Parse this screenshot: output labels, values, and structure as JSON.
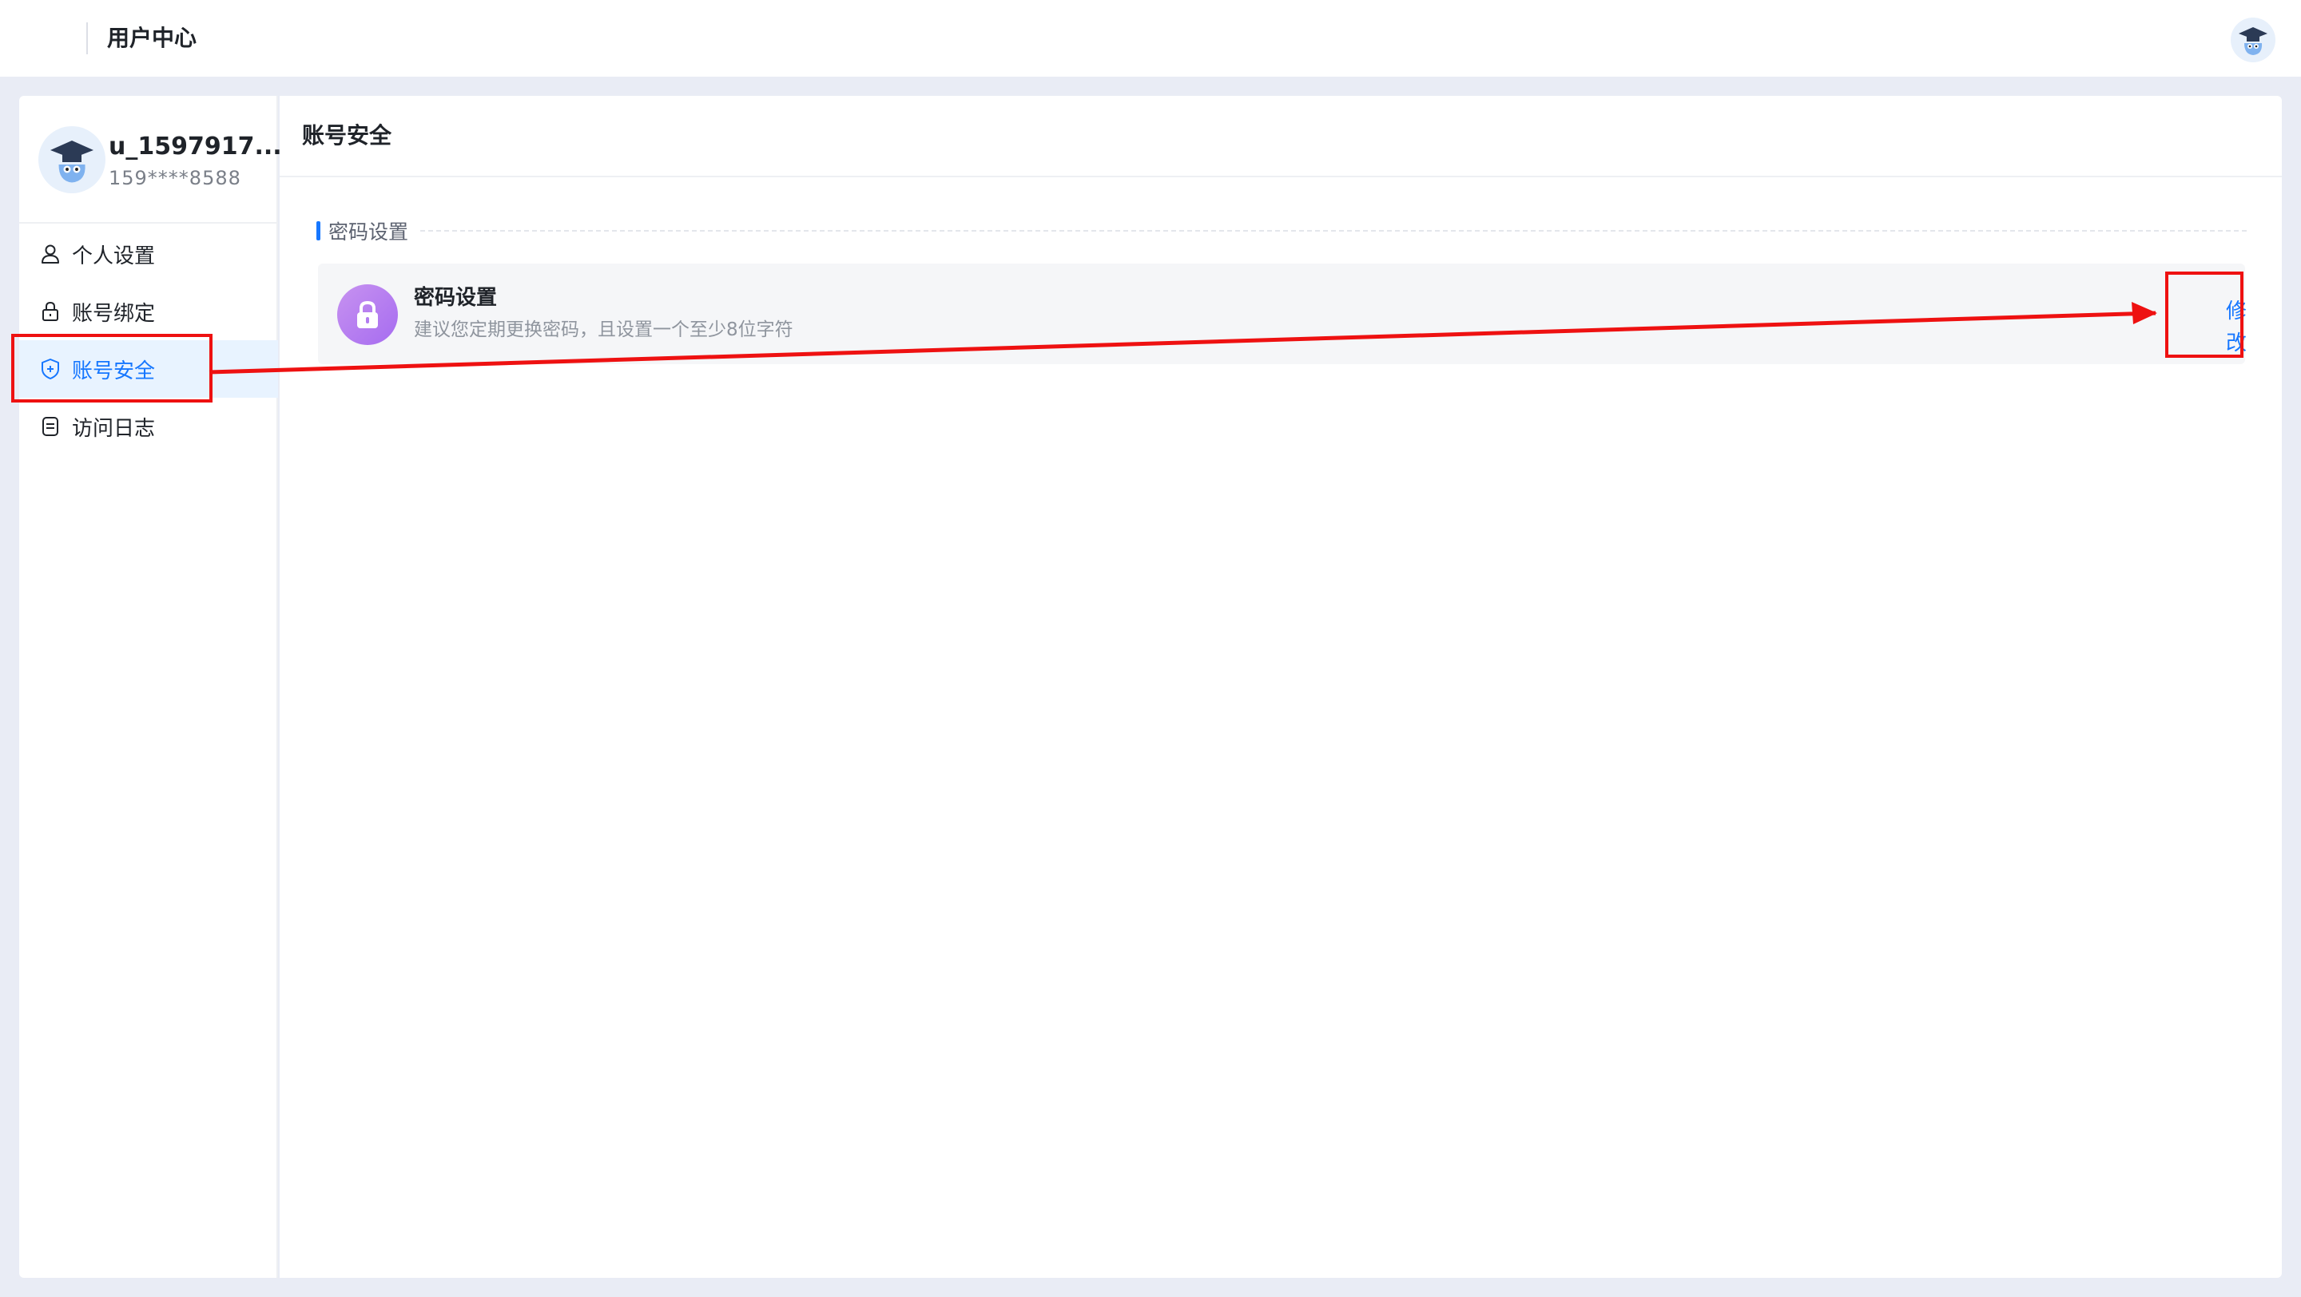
{
  "header": {
    "title": "用户中心"
  },
  "profile": {
    "username": "u_1597917...",
    "phone": "159****8588"
  },
  "sidebar": {
    "items": [
      {
        "label": "个人设置",
        "icon": "user-icon",
        "active": false
      },
      {
        "label": "账号绑定",
        "icon": "lock-icon",
        "active": false
      },
      {
        "label": "账号安全",
        "icon": "shield-icon",
        "active": true
      },
      {
        "label": "访问日志",
        "icon": "document-icon",
        "active": false
      }
    ]
  },
  "main": {
    "title": "账号安全",
    "section_title": "密码设置",
    "card": {
      "icon": "lock-icon",
      "title": "密码设置",
      "description": "建议您定期更换密码，且设置一个至少8位字符",
      "action_label": "修改"
    }
  },
  "colors": {
    "accent": "#1677ff",
    "annotation": "#ee1111",
    "lock_gradient_start": "#c792f0",
    "lock_gradient_end": "#a66cf0"
  }
}
